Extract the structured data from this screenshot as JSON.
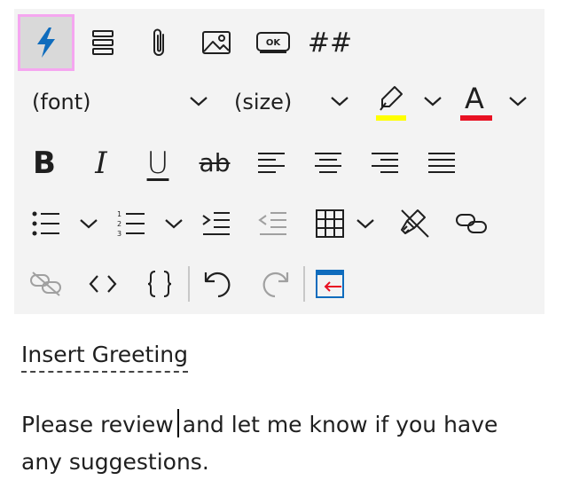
{
  "colors": {
    "toolbar_bg": "#f3f3f3",
    "active_border": "#f5a6f0",
    "active_bg": "#d9d9d9",
    "accent_blue": "#0f6cbd",
    "highlight_yellow": "#ffff00",
    "font_color_red": "#e81123",
    "disabled_gray": "#a0a0a0",
    "embed_red": "#e81123"
  },
  "toolbar": {
    "row1": [
      {
        "name": "quick-parts-button",
        "icon": "lightning-icon",
        "active": true
      },
      {
        "name": "layout-button",
        "icon": "stacked-lines-icon"
      },
      {
        "name": "attach-button",
        "icon": "paperclip-icon"
      },
      {
        "name": "insert-image-button",
        "icon": "image-icon"
      },
      {
        "name": "button-insert",
        "icon": "ok-button-icon",
        "label": "OK"
      },
      {
        "name": "merge-field-button",
        "icon": "hash-icon",
        "label": "##"
      }
    ],
    "font": {
      "label": "(font)"
    },
    "size": {
      "label": "(size)"
    },
    "font_color_letter": "A",
    "format": {
      "bold": "B",
      "italic": "I",
      "underline": "U",
      "strike": "ab"
    }
  },
  "content": {
    "greeting": "Insert Greeting",
    "body_before_cursor": "Please review",
    "body_after_cursor": "and let me know if you have any suggestions."
  }
}
